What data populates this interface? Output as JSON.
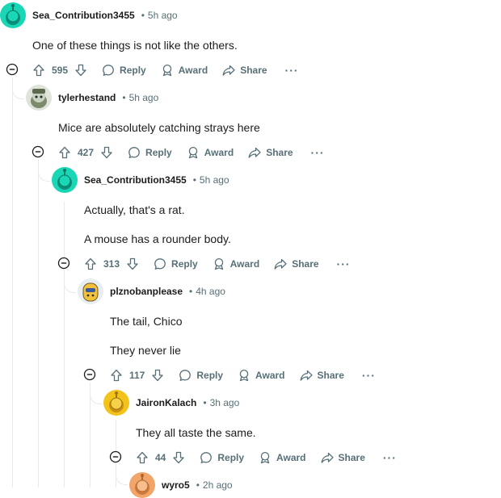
{
  "comments": [
    {
      "author": "Sea_Contribution3455",
      "dot": "•",
      "time": "5h ago",
      "body": [
        "One of these things is not like the others."
      ],
      "score": "595",
      "avatar_color": "#19d6b4"
    },
    {
      "author": "tylerhestand",
      "dot": "•",
      "time": "5h ago",
      "body": [
        "Mice are absolutely catching strays here"
      ],
      "score": "427",
      "avatar_color": "#8c9a7a"
    },
    {
      "author": "Sea_Contribution3455",
      "dot": "•",
      "time": "5h ago",
      "body": [
        "Actually, that's a rat.",
        "A mouse has a rounder body."
      ],
      "score": "313",
      "avatar_color": "#19d6b4"
    },
    {
      "author": "plznobanplease",
      "dot": "•",
      "time": "4h ago",
      "body": [
        "The tail, Chico",
        "They never lie"
      ],
      "score": "117",
      "avatar_color": "#f3c13a"
    },
    {
      "author": "JaironKalach",
      "dot": "•",
      "time": "3h ago",
      "body": [
        "They all taste the same."
      ],
      "score": "44",
      "avatar_color": "#f2c41b"
    },
    {
      "author": "wyro5",
      "dot": "•",
      "time": "2h ago",
      "body": [],
      "score": "",
      "avatar_color": "#f2a56b"
    }
  ],
  "actions": {
    "reply": "Reply",
    "award": "Award",
    "share": "Share",
    "more": "···"
  },
  "colors": {
    "meta_text": "#576f76",
    "thread_line": "#e5ebee",
    "body_text": "#1c1c1c"
  },
  "icons": [
    "collapse-icon",
    "upvote-icon",
    "downvote-icon",
    "reply-icon",
    "award-icon",
    "share-icon",
    "more-icon"
  ]
}
